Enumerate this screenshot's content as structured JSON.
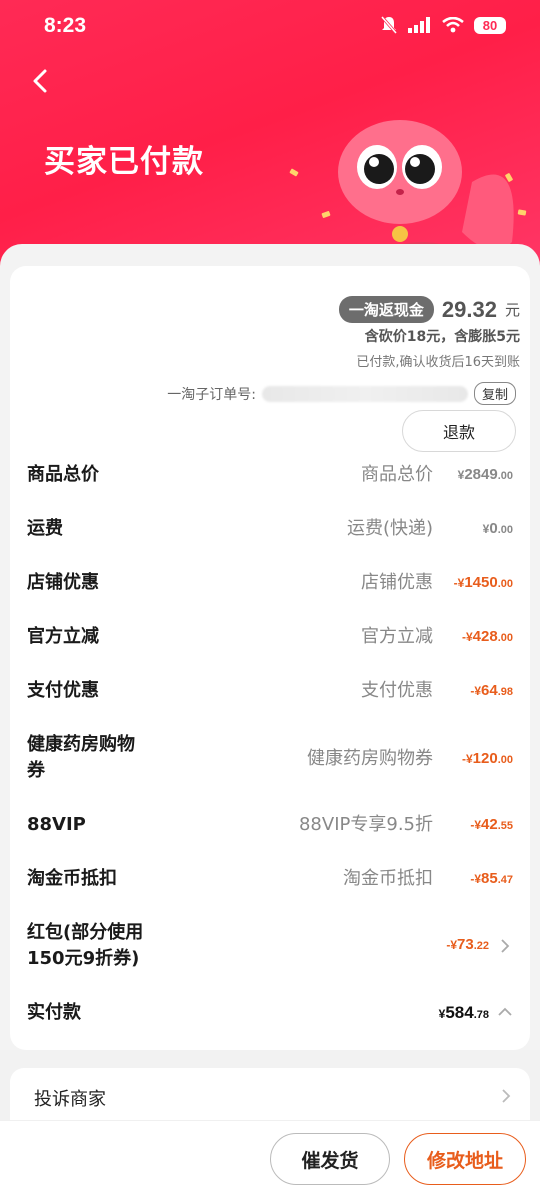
{
  "status_bar": {
    "time": "8:23",
    "battery": "80"
  },
  "header": {
    "title": "买家已付款"
  },
  "cashback": {
    "pill": "一淘返现金",
    "amount": "29.32",
    "unit": "元",
    "sub1": "含砍价18元，含膨胀5元",
    "sub2": "已付款,确认收货后16天到账"
  },
  "order": {
    "label": "一淘子订单号:",
    "copy": "复制"
  },
  "refund_button": "退款",
  "fees": [
    {
      "label": "商品总价",
      "desc": "商品总价",
      "yen": "¥",
      "int": "2849",
      "dec": ".00",
      "color": "grey"
    },
    {
      "label": "运费",
      "desc": "运费(快递)",
      "yen": "¥",
      "int": "0",
      "dec": ".00",
      "color": "grey"
    },
    {
      "label": "店铺优惠",
      "desc": "店铺优惠",
      "yen": "-¥",
      "int": "1450",
      "dec": ".00",
      "color": "orange"
    },
    {
      "label": "官方立减",
      "desc": "官方立减",
      "yen": "-¥",
      "int": "428",
      "dec": ".00",
      "color": "orange"
    },
    {
      "label": "支付优惠",
      "desc": "支付优惠",
      "yen": "-¥",
      "int": "64",
      "dec": ".98",
      "color": "orange"
    },
    {
      "label_line1": "健康药房购物",
      "label_line2": "券",
      "desc": "健康药房购物券",
      "yen": "-¥",
      "int": "120",
      "dec": ".00",
      "color": "orange"
    },
    {
      "label": "88VIP",
      "desc": "88VIP专享9.5折",
      "yen": "-¥",
      "int": "42",
      "dec": ".55",
      "color": "orange"
    },
    {
      "label": "淘金币抵扣",
      "desc": "淘金币抵扣",
      "yen": "-¥",
      "int": "85",
      "dec": ".47",
      "color": "orange"
    },
    {
      "label_line1": "红包(部分使用",
      "label_line2": "150元9折券)",
      "desc": "",
      "yen": "-¥",
      "int": "73",
      "dec": ".22",
      "color": "orange"
    },
    {
      "label": "实付款",
      "desc": "",
      "yen": "¥",
      "int": "584",
      "dec": ".78",
      "color": "black"
    }
  ],
  "complain": {
    "label": "投诉商家"
  },
  "actions": {
    "urge": "催发货",
    "change_address": "修改地址"
  },
  "colors": {
    "header_red": "#ff2a55",
    "accent_orange": "#e85d1c"
  }
}
